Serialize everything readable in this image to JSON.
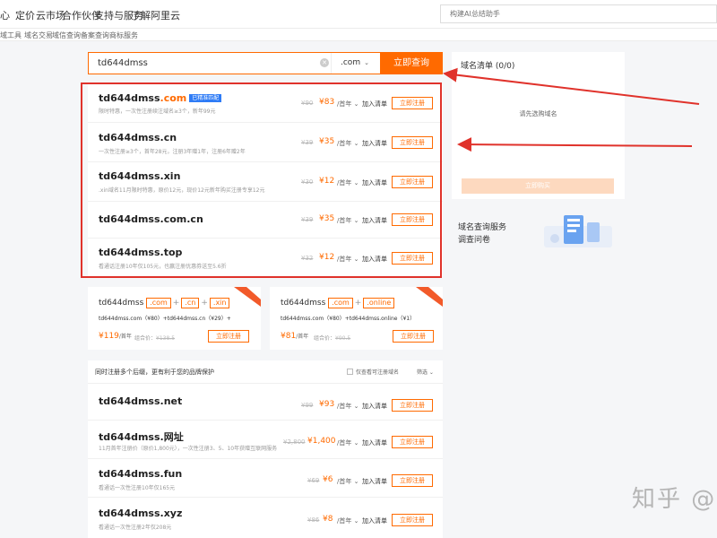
{
  "topnav": {
    "items": [
      "心",
      "定价",
      "云市场",
      "合作伙伴",
      "支持与服务",
      "了解阿里云"
    ],
    "search_placeholder": "构建AI总结助手"
  },
  "subnav": {
    "items": [
      "域工具",
      "域名交易",
      "域信查询",
      "备案查询",
      "商标服务"
    ]
  },
  "search": {
    "value": "td644dmss",
    "tld": ".com",
    "query_label": "立即查询"
  },
  "results": [
    {
      "prefix": "td644dmss",
      "tld": ".com",
      "tld_color": "#ff6a00",
      "badge": "已精准匹配",
      "desc": "限时特惠，一次性注册续注域名≥3个，新年99元",
      "old_price": "¥90",
      "price": "¥83",
      "unit": "/首年",
      "add": "加入清单",
      "register": "立即注册"
    },
    {
      "prefix": "td644dmss",
      "tld": ".cn",
      "tld_color": "#222222",
      "badge": "",
      "desc": "一次性注册≥3个，首年28元，注册3年赠1年，注册6年赠2年",
      "old_price": "¥39",
      "price": "¥35",
      "unit": "/首年",
      "add": "加入清单",
      "register": "立即注册"
    },
    {
      "prefix": "td644dmss",
      "tld": ".xin",
      "tld_color": "#222222",
      "badge": "",
      "desc": ".xin域名11月限时特惠，原价12元，现价12元新年购买注册专享12元",
      "old_price": "¥30",
      "price": "¥12",
      "unit": "/首年",
      "add": "加入清单",
      "register": "立即注册"
    },
    {
      "prefix": "td644dmss",
      "tld": ".com.cn",
      "tld_color": "#222222",
      "badge": "",
      "desc": "",
      "old_price": "¥39",
      "price": "¥35",
      "unit": "/首年",
      "add": "加入清单",
      "register": "立即注册"
    },
    {
      "prefix": "td644dmss",
      "tld": ".top",
      "tld_color": "#222222",
      "badge": "",
      "desc": "看通话注册10年仅105元，也赢注册优惠券送至5.6折",
      "old_price": "¥32",
      "price": "¥12",
      "unit": "/首年",
      "add": "加入清单",
      "register": "立即注册"
    }
  ],
  "cart": {
    "title": "域名清单 (0/0)",
    "empty_text": "请先选购域名",
    "button": "立即购买"
  },
  "survey": {
    "line1": "域名查询服务",
    "line2": "调查问卷"
  },
  "combos": [
    {
      "name": "td644dmss",
      "tlds": [
        ".com",
        ".cn",
        ".xin"
      ],
      "detail_a": "td644dmss.com",
      "detail_a_price": "（¥80）",
      "detail_b": "+td644dmss.cn",
      "detail_b_price": "（¥29）",
      "detail_c": "+",
      "price": "¥119",
      "unit": "/首年",
      "orig_label": "组合价：",
      "orig_price": "¥138.5",
      "button": "立即注册"
    },
    {
      "name": "td644dmss",
      "tlds": [
        ".com",
        ".online"
      ],
      "detail_a": "td644dmss.com",
      "detail_a_price": "（¥80）",
      "detail_b": "+td644dmss.online",
      "detail_b_price": "（¥1）",
      "detail_c": "",
      "price": "¥81",
      "unit": "/首年",
      "orig_label": "组合价：",
      "orig_price": "¥90.5",
      "button": "立即注册"
    }
  ],
  "multi": {
    "title": "同时注册多个后缀，更有利于您的品牌保护",
    "only_registrable": "仅查看可注册域名",
    "filter": "筛选",
    "rows": [
      {
        "prefix": "td644dmss",
        "tld": ".net",
        "desc": "",
        "old_price": "¥99",
        "price": "¥93",
        "unit": "/首年",
        "add": "加入清单",
        "register": "立即注册"
      },
      {
        "prefix": "td644dmss",
        "tld": ".网址",
        "desc": "11月首年注册价（原价1,800元），一次性注册3、5、10年获赠互联网服务",
        "old_price": "¥2,800",
        "price": "¥1,400",
        "unit": "/首年",
        "add": "加入清单",
        "register": "立即注册"
      },
      {
        "prefix": "td644dmss",
        "tld": ".fun",
        "desc": "看通话一次性注册10年仅165元",
        "old_price": "¥69",
        "price": "¥6",
        "unit": "/首年",
        "add": "加入清单",
        "register": "立即注册"
      },
      {
        "prefix": "td644dmss",
        "tld": ".xyz",
        "desc": "看通话一次性注册2年仅208元",
        "old_price": "¥86",
        "price": "¥8",
        "unit": "/首年",
        "add": "加入清单",
        "register": "立即注册"
      }
    ]
  },
  "watermark": "知乎 @",
  "colors": {
    "accent": "#ff6a00",
    "annotation_red": "#e0322b",
    "badge_blue": "#2f7cf6"
  }
}
